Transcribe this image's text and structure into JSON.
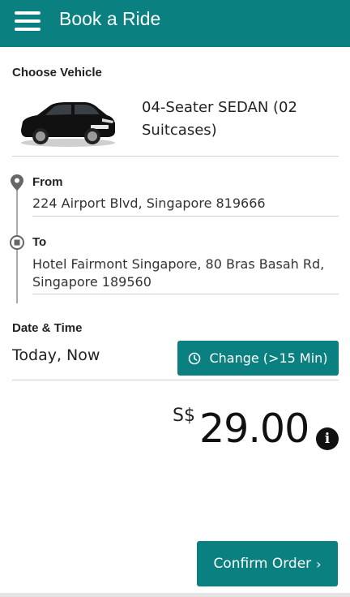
{
  "header": {
    "title": "Book a Ride"
  },
  "vehicle": {
    "section_label": "Choose Vehicle",
    "name": "04-Seater SEDAN (02 Suitcases)"
  },
  "route": {
    "from_label": "From",
    "from_value": "224 Airport Blvd, Singapore 819666",
    "to_label": "To",
    "to_value": "Hotel Fairmont Singapore, 80 Bras Basah Rd, Singapore 189560"
  },
  "schedule": {
    "section_label": "Date & Time",
    "value": "Today, Now",
    "change_label": "Change (>15 Min)"
  },
  "price": {
    "currency": "S$",
    "amount": "29.00"
  },
  "actions": {
    "confirm_label": "Confirm Order",
    "confirm_chevron": "›"
  },
  "colors": {
    "brand": "#0a8080"
  },
  "icons": [
    "menu-icon",
    "car-image",
    "location-pin-icon",
    "destination-stop-icon",
    "clock-icon",
    "info-icon",
    "chevron-right-icon"
  ]
}
